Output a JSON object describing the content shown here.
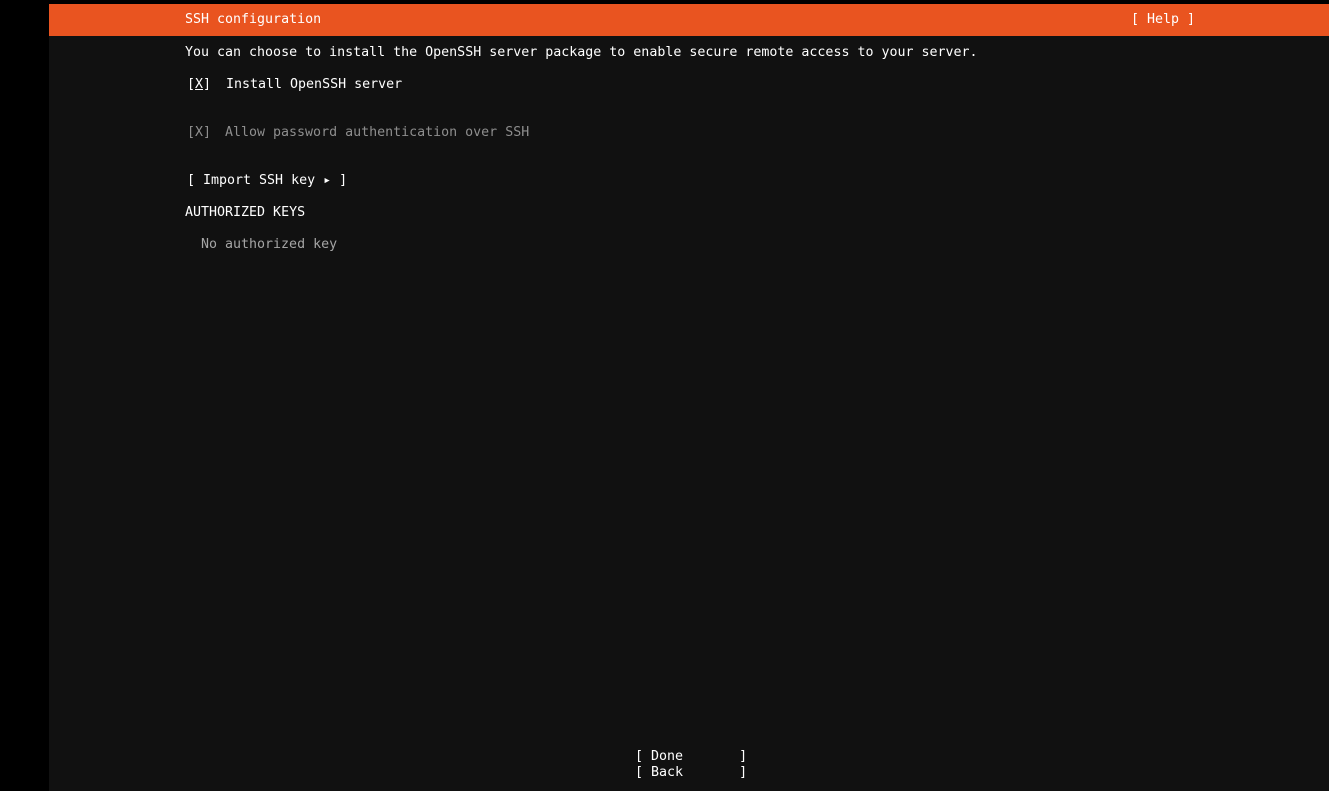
{
  "header": {
    "title": "SSH configuration",
    "help_label": "[ Help ]",
    "accent_color": "#e95420"
  },
  "description": "You can choose to install the OpenSSH server package to enable secure remote access to your server.",
  "install_openssh": {
    "checkbox_open": "[",
    "checkbox_mark": "X",
    "checkbox_close": "]",
    "label": "Install OpenSSH server",
    "checked": true
  },
  "password_auth": {
    "checkbox": "[X]",
    "label": "Allow password authentication over SSH",
    "checked": true,
    "disabled": true
  },
  "import_key_button": "[ Import SSH key ▸ ]",
  "authorized_keys": {
    "heading": "AUTHORIZED KEYS",
    "empty_text": "No authorized key"
  },
  "footer": {
    "done_label": "[ Done       ]",
    "back_label": "[ Back       ]"
  }
}
